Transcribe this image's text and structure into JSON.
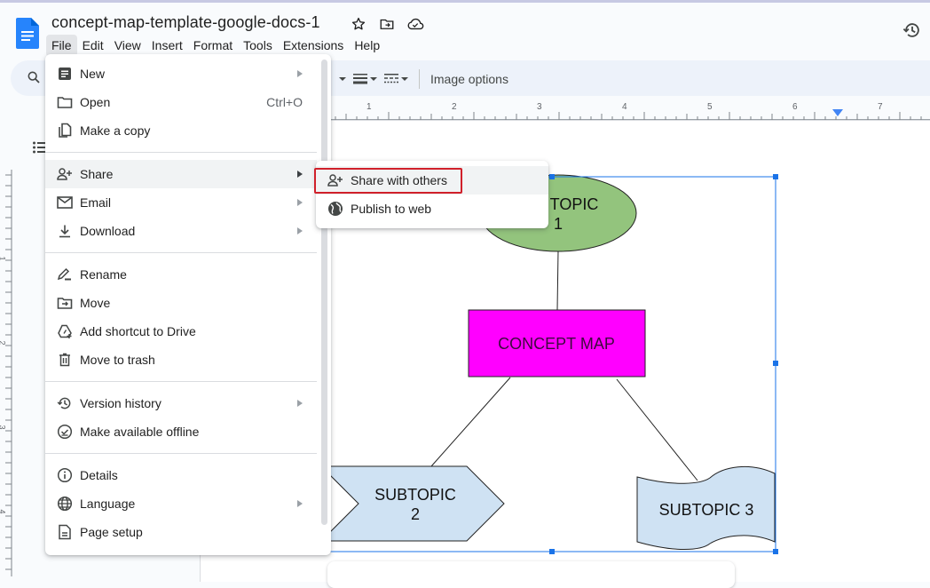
{
  "window": {
    "doc_title": "concept-map-template-google-docs-1",
    "title_icons": [
      "star-icon",
      "move-to-folder-icon",
      "cloud-saved-icon"
    ],
    "history_icon": "version-history-icon"
  },
  "menubar": {
    "items": [
      {
        "label": "File",
        "active": true
      },
      {
        "label": "Edit"
      },
      {
        "label": "View"
      },
      {
        "label": "Insert"
      },
      {
        "label": "Format"
      },
      {
        "label": "Tools"
      },
      {
        "label": "Extensions"
      },
      {
        "label": "Help"
      }
    ]
  },
  "toolbar": {
    "image_options_label": "Image options"
  },
  "ruler": {
    "horizontal_labels": [
      "1",
      "2",
      "3",
      "4",
      "5",
      "6",
      "7"
    ],
    "vertical_labels": [
      "1",
      "2",
      "3",
      "4"
    ]
  },
  "file_menu": {
    "groups": [
      [
        {
          "label": "New",
          "icon": "document-icon",
          "submenu": true
        },
        {
          "label": "Open",
          "icon": "folder-icon",
          "shortcut": "Ctrl+O"
        },
        {
          "label": "Make a copy",
          "icon": "copy-icon"
        }
      ],
      [
        {
          "label": "Share",
          "icon": "person-add-icon",
          "submenu": true,
          "hover": true
        },
        {
          "label": "Email",
          "icon": "email-icon",
          "submenu": true
        },
        {
          "label": "Download",
          "icon": "download-icon",
          "submenu": true
        }
      ],
      [
        {
          "label": "Rename",
          "icon": "rename-icon"
        },
        {
          "label": "Move",
          "icon": "move-folder-icon"
        },
        {
          "label": "Add shortcut to Drive",
          "icon": "drive-shortcut-icon"
        },
        {
          "label": "Move to trash",
          "icon": "trash-icon"
        }
      ],
      [
        {
          "label": "Version history",
          "icon": "history-icon",
          "submenu": true
        },
        {
          "label": "Make available offline",
          "icon": "offline-icon"
        }
      ],
      [
        {
          "label": "Details",
          "icon": "info-icon"
        },
        {
          "label": "Language",
          "icon": "globe-icon",
          "submenu": true
        },
        {
          "label": "Page setup",
          "icon": "page-setup-icon"
        }
      ]
    ]
  },
  "share_submenu": {
    "items": [
      {
        "label": "Share with others",
        "icon": "person-add-icon",
        "highlighted": true
      },
      {
        "label": "Publish to web",
        "icon": "globe-filled-icon"
      }
    ]
  },
  "concept_map": {
    "topic1": {
      "line1": "TOPIC",
      "line2": "1",
      "fill": "#93c47d"
    },
    "center": {
      "label": "CONCEPT MAP",
      "fill": "#ff00ff"
    },
    "subtopic2": {
      "line1": "SUBTOPIC",
      "line2": "2",
      "fill": "#cfe2f3"
    },
    "subtopic3": {
      "label": "SUBTOPIC 3",
      "fill": "#cfe2f3"
    }
  },
  "colors": {
    "accent": "#1a73e8",
    "highlight_box": "#d0202a",
    "toolbar_bg": "#edf2fa"
  }
}
